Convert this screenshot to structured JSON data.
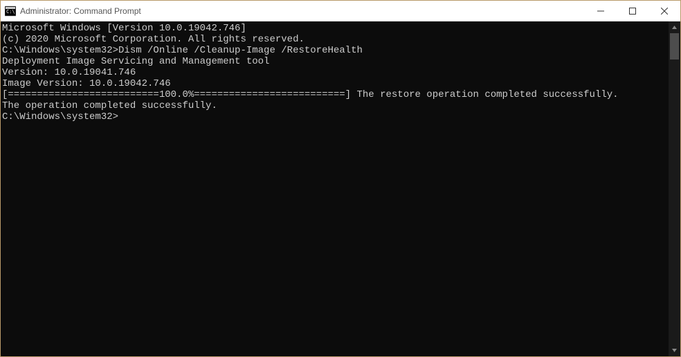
{
  "titlebar": {
    "title": "Administrator: Command Prompt"
  },
  "console": {
    "lines": [
      "Microsoft Windows [Version 10.0.19042.746]",
      "(c) 2020 Microsoft Corporation. All rights reserved.",
      "",
      "C:\\Windows\\system32>Dism /Online /Cleanup-Image /RestoreHealth",
      "",
      "Deployment Image Servicing and Management tool",
      "Version: 10.0.19041.746",
      "",
      "Image Version: 10.0.19042.746",
      "",
      "[==========================100.0%==========================] The restore operation completed successfully.",
      "The operation completed successfully.",
      "",
      "C:\\Windows\\system32>"
    ],
    "prompt_prefix": "C:\\Windows\\system32>",
    "command": "Dism /Online /Cleanup-Image /RestoreHealth",
    "windows_version": "10.0.19042.746",
    "dism_version": "10.0.19041.746",
    "image_version": "10.0.19042.746",
    "progress_percent": "100.0%",
    "status_1": "The restore operation completed successfully.",
    "status_2": "The operation completed successfully."
  }
}
